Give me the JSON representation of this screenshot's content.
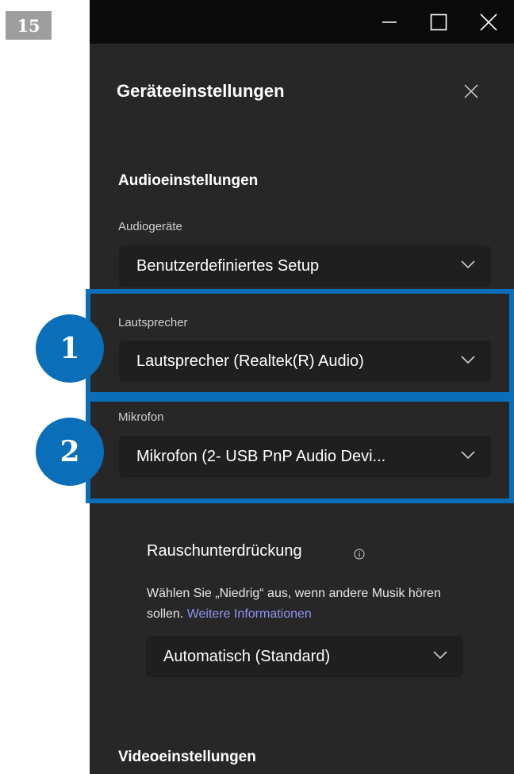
{
  "step_number": "15",
  "window": {
    "minimize_icon": "minimize-icon",
    "maximize_icon": "maximize-icon",
    "close_icon": "close-icon"
  },
  "dialog": {
    "title": "Geräteeinstellungen",
    "audio_section_title": "Audioeinstellungen",
    "audio_devices": {
      "label": "Audiogeräte",
      "value": "Benutzerdefiniertes Setup"
    },
    "speaker": {
      "label": "Lautsprecher",
      "value": "Lautsprecher (Realtek(R) Audio)"
    },
    "microphone": {
      "label": "Mikrofon",
      "value": "Mikrofon (2- USB PnP Audio Devi..."
    },
    "noise_suppression": {
      "title": "Rauschunterdrückung",
      "description": "Wählen Sie „Niedrig“ aus, wenn andere Musik hören sollen.",
      "link": "Weitere Informationen",
      "value": "Automatisch (Standard)"
    },
    "video_section_title": "Videoeinstellungen"
  },
  "callouts": [
    "1",
    "2"
  ],
  "colors": {
    "callout_blue": "#0a6fb8",
    "panel_bg": "#272727",
    "dropdown_bg": "#1f1f1f",
    "link": "#8f95f2"
  }
}
